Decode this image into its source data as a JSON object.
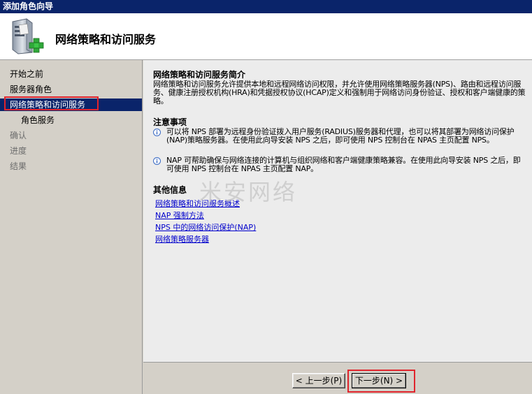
{
  "window": {
    "title": "添加角色向导"
  },
  "header": {
    "title": "网络策略和访问服务",
    "icon": "server-add-icon"
  },
  "sidebar": {
    "items": [
      {
        "label": "开始之前",
        "state": "done"
      },
      {
        "label": "服务器角色",
        "state": "done"
      },
      {
        "label": "网络策略和访问服务",
        "state": "active"
      },
      {
        "label": "角色服务",
        "state": "done"
      },
      {
        "label": "确认",
        "state": "pending"
      },
      {
        "label": "进度",
        "state": "pending"
      },
      {
        "label": "结果",
        "state": "pending"
      }
    ]
  },
  "content": {
    "intro_heading": "网络策略和访问服务简介",
    "intro_text": "网络策略和访问服务允许提供本地和远程网络访问权限，并允许使用网络策略服务器(NPS)、路由和远程访问服务、健康注册授权机构(HRA)和凭据授权协议(HCAP)定义和强制用于网络访问身份验证、授权和客户端健康的策略。",
    "notes_heading": "注意事项",
    "notes": [
      "可以将 NPS 部署为远程身份验证拨入用户服务(RADIUS)服务器和代理，也可以将其部署为网络访问保护(NAP)策略服务器。在使用此向导安装 NPS 之后，即可使用 NPS 控制台在 NPAS 主页配置 NPS。",
      "NAP 可帮助确保与网络连接的计算机与组织网络和客户端健康策略兼容。在使用此向导安装 NPS 之后，即可使用 NPS 控制台在 NPAS 主页配置 NAP。"
    ],
    "info_heading": "其他信息",
    "links": [
      "网络策略和访问服务概述",
      "NAP 强制方法",
      "NPS 中的网络访问保护(NAP)",
      "网络策略服务器"
    ]
  },
  "watermark": "米安网络",
  "footer": {
    "prev_label": "< 上一步(P)",
    "next_label": "下一步(N) >"
  },
  "colors": {
    "titlebar": "#0a246a",
    "highlight": "#0a246a",
    "callout": "#e0242c",
    "link": "#0000cc"
  }
}
